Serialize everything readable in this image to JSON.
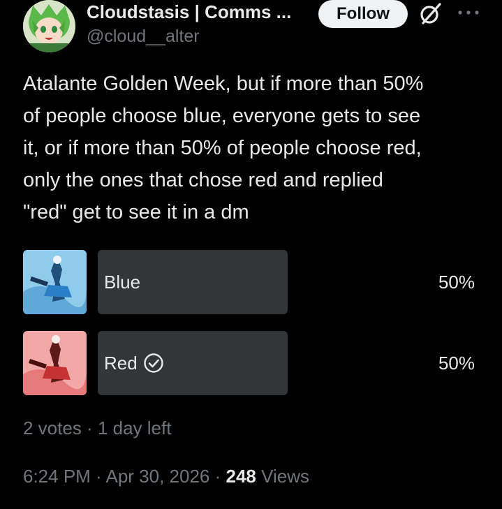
{
  "header": {
    "display_name": "Cloudstasis | Comms ...",
    "handle": "@cloud__alter",
    "follow_label": "Follow",
    "grok_icon": "grok-slash-icon",
    "more_icon": "more-dots-icon"
  },
  "tweet": {
    "text": "Atalante Golden Week, but if more than 50%\nof people choose blue, everyone gets to see\nit, or if more than 50% of people choose red,\nonly the ones that chose red and replied\n\"red\" get to see it in a dm"
  },
  "poll": {
    "options": [
      {
        "label": "Blue",
        "percent": "50%",
        "fill_fraction": 0.5,
        "selected": false,
        "thumb_color": "#6ab4e0"
      },
      {
        "label": "Red",
        "percent": "50%",
        "fill_fraction": 0.5,
        "selected": true,
        "thumb_color": "#e87878"
      }
    ],
    "votes": "2 votes",
    "separator": " · ",
    "time_left": "1 day left"
  },
  "footer": {
    "time": "6:24 PM",
    "date": "Apr 30, 2026",
    "separator": " · ",
    "views_count": "248",
    "views_label": " Views"
  },
  "colors": {
    "background": "#000000",
    "text": "#e7e9ea",
    "muted": "#71767b",
    "poll_bar": "#333639",
    "follow_bg": "#eff3f4"
  }
}
